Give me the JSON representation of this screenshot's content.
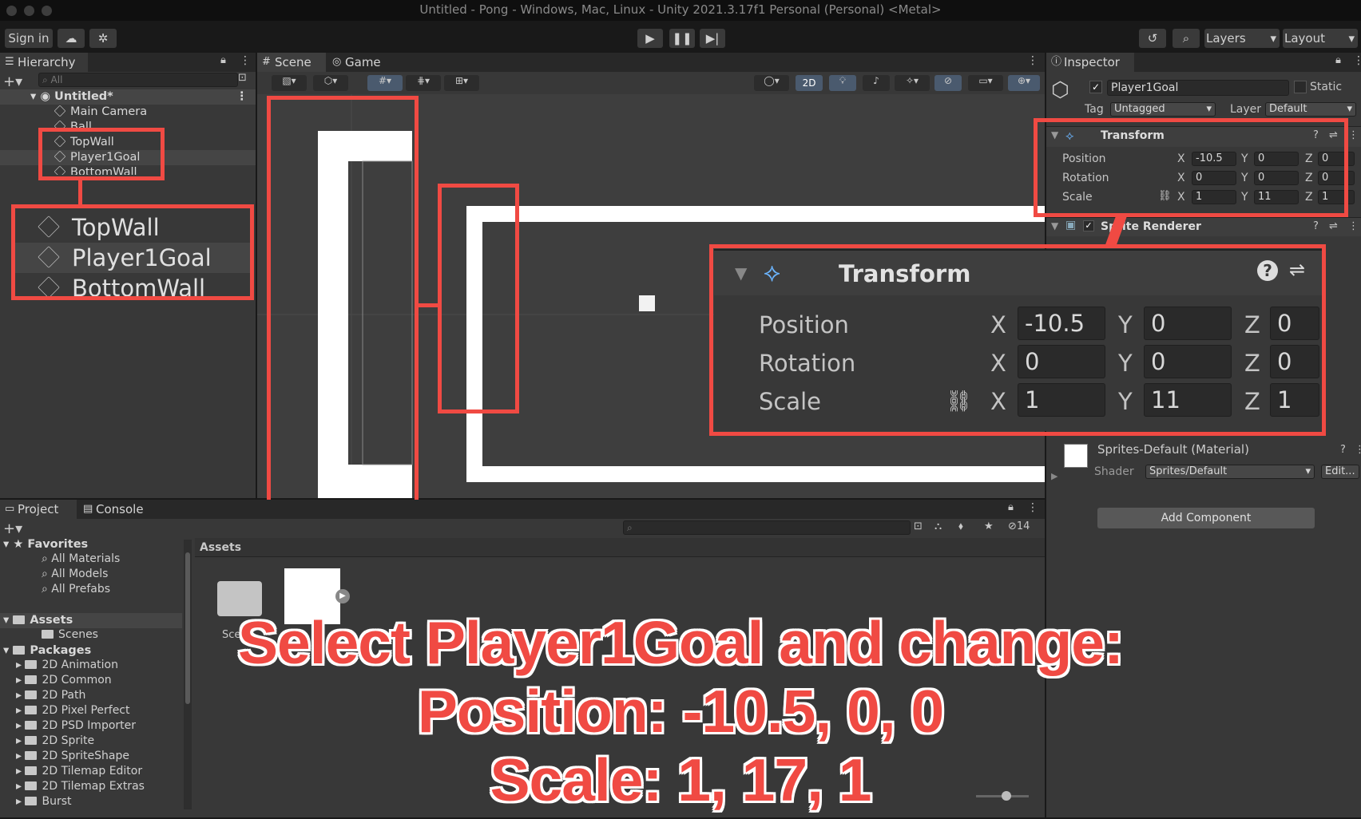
{
  "window": {
    "title": "Untitled - Pong - Windows, Mac, Linux - Unity 2021.3.17f1 Personal (Personal) <Metal>"
  },
  "toolbar": {
    "sign_in": "Sign in",
    "layers": "Layers",
    "layout": "Layout"
  },
  "hierarchy": {
    "tab": "Hierarchy",
    "search_placeholder": "All",
    "scene": "Untitled*",
    "items": [
      "Main Camera",
      "Ball",
      "TopWall",
      "Player1Goal",
      "BottomWall"
    ]
  },
  "hierarchy_zoom": {
    "items": [
      "TopWall",
      "Player1Goal",
      "BottomWall"
    ]
  },
  "scene_view": {
    "tabs": [
      "Scene",
      "Game"
    ],
    "mode_2d": "2D"
  },
  "inspector": {
    "tab": "Inspector",
    "object_name": "Player1Goal",
    "static_label": "Static",
    "tag_label": "Tag",
    "tag_value": "Untagged",
    "layer_label": "Layer",
    "layer_value": "Default",
    "transform": {
      "title": "Transform",
      "position_label": "Position",
      "rotation_label": "Rotation",
      "scale_label": "Scale",
      "position": {
        "x": "-10.5",
        "y": "0",
        "z": "0"
      },
      "rotation": {
        "x": "0",
        "y": "0",
        "z": "0"
      },
      "scale": {
        "x": "1",
        "y": "11",
        "z": "1"
      },
      "axis_x": "X",
      "axis_y": "Y",
      "axis_z": "Z"
    },
    "sprite_renderer": "Sprite Renderer",
    "material": "Sprites-Default (Material)",
    "shader_label": "Shader",
    "shader_value": "Sprites/Default",
    "edit_label": "Edit...",
    "add_component": "Add Component"
  },
  "project": {
    "tabs": [
      "Project",
      "Console"
    ],
    "favorites": "Favorites",
    "favorite_items": [
      "All Materials",
      "All Models",
      "All Prefabs"
    ],
    "assets": "Assets",
    "asset_items": [
      "Scenes"
    ],
    "packages": "Packages",
    "package_items": [
      "2D Animation",
      "2D Common",
      "2D Path",
      "2D Pixel Perfect",
      "2D PSD Importer",
      "2D Sprite",
      "2D SpriteShape",
      "2D Tilemap Editor",
      "2D Tilemap Extras",
      "Burst"
    ],
    "breadcrumb": "Assets",
    "hidden_count": "14",
    "folder_label": "Sce"
  },
  "caption": {
    "line1": "Select Player1Goal and change:",
    "line2": "Position: -10.5, 0, 0",
    "line3": "Scale: 1, 17, 1"
  },
  "colors": {
    "highlight": "#f04a43",
    "panel": "#383838",
    "field": "#2a2a2a"
  }
}
